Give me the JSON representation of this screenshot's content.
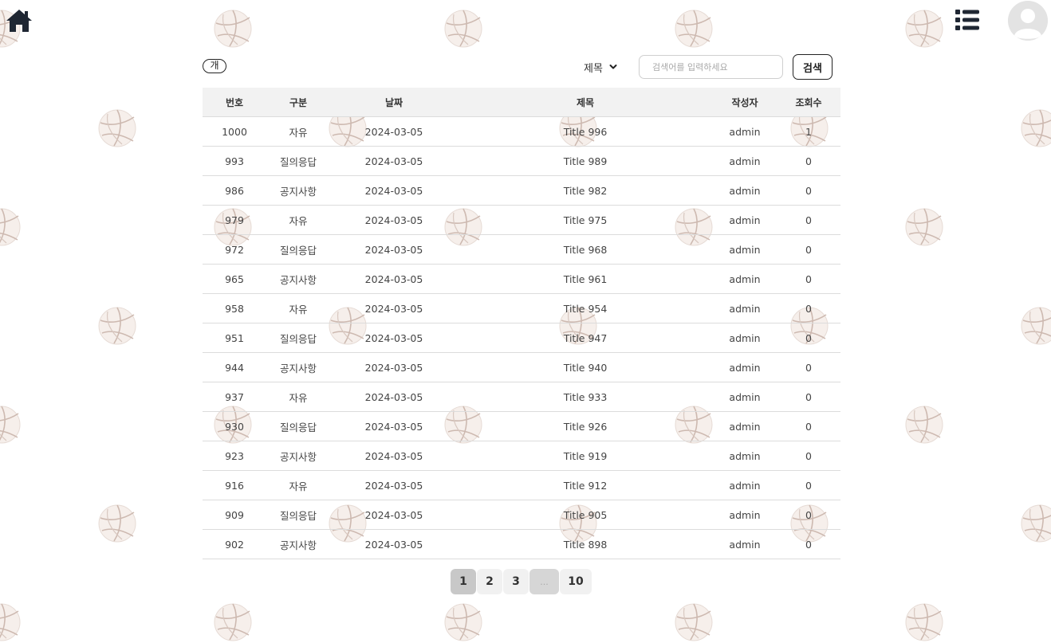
{
  "header": {
    "home_icon": "home-icon",
    "menu_icon": "list-icon",
    "avatar_icon": "user-avatar-icon"
  },
  "toolbar": {
    "count_label": "개",
    "search_field_selected": "제목",
    "search_placeholder": "검색어를 입력하세요",
    "search_button_label": "검색"
  },
  "table": {
    "columns": [
      "번호",
      "구분",
      "날짜",
      "제목",
      "작성자",
      "조회수"
    ],
    "rows": [
      [
        "1000",
        "자유",
        "2024-03-05",
        "Title 996",
        "admin",
        "1"
      ],
      [
        "993",
        "질의응답",
        "2024-03-05",
        "Title 989",
        "admin",
        "0"
      ],
      [
        "986",
        "공지사항",
        "2024-03-05",
        "Title 982",
        "admin",
        "0"
      ],
      [
        "979",
        "자유",
        "2024-03-05",
        "Title 975",
        "admin",
        "0"
      ],
      [
        "972",
        "질의응답",
        "2024-03-05",
        "Title 968",
        "admin",
        "0"
      ],
      [
        "965",
        "공지사항",
        "2024-03-05",
        "Title 961",
        "admin",
        "0"
      ],
      [
        "958",
        "자유",
        "2024-03-05",
        "Title 954",
        "admin",
        "0"
      ],
      [
        "951",
        "질의응답",
        "2024-03-05",
        "Title 947",
        "admin",
        "0"
      ],
      [
        "944",
        "공지사항",
        "2024-03-05",
        "Title 940",
        "admin",
        "0"
      ],
      [
        "937",
        "자유",
        "2024-03-05",
        "Title 933",
        "admin",
        "0"
      ],
      [
        "930",
        "질의응답",
        "2024-03-05",
        "Title 926",
        "admin",
        "0"
      ],
      [
        "923",
        "공지사항",
        "2024-03-05",
        "Title 919",
        "admin",
        "0"
      ],
      [
        "916",
        "자유",
        "2024-03-05",
        "Title 912",
        "admin",
        "0"
      ],
      [
        "909",
        "질의응답",
        "2024-03-05",
        "Title 905",
        "admin",
        "0"
      ],
      [
        "902",
        "공지사항",
        "2024-03-05",
        "Title 898",
        "admin",
        "0"
      ]
    ]
  },
  "pagination": {
    "pages": [
      "1",
      "2",
      "3",
      "...",
      "10"
    ],
    "current": "1"
  },
  "colors": {
    "icon_dark": "#1f2733",
    "header_bg": "#f2f2f2",
    "row_border": "#dcdcdc",
    "ball_fill": "#f5eeea",
    "ball_stroke": "#c9b6ad"
  }
}
